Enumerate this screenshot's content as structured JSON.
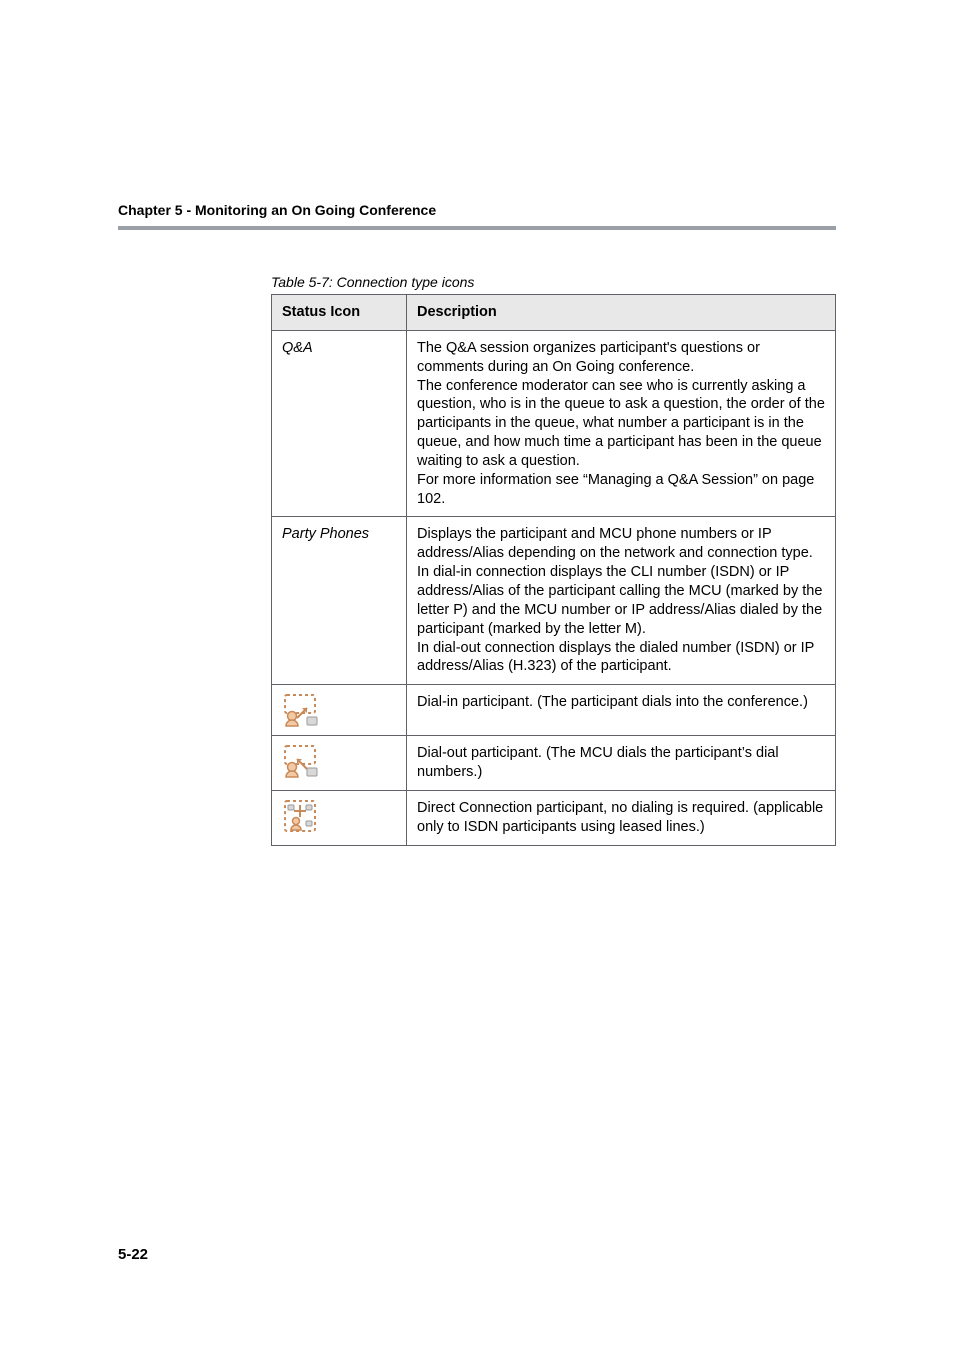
{
  "chapter": "Chapter 5 - Monitoring an On Going Conference",
  "table": {
    "caption": "Table 5-7: Connection type icons",
    "headers": {
      "col1": "Status Icon",
      "col2": "Description"
    },
    "rows": {
      "qa": {
        "label": "Q&A",
        "desc": "The Q&A session organizes participant's questions or comments during an On Going conference.\nThe conference moderator can see who is currently asking a question, who is in the queue to ask a question, the order of the participants in the queue, what number a participant is in the queue, and how much time a participant has been in the queue waiting to ask a question.\nFor more information see “Managing a Q&A Session” on page 102."
      },
      "party_phones": {
        "label": "Party Phones",
        "desc": "Displays the participant and MCU phone numbers or IP address/Alias depending on the network and connection type.\nIn dial-in connection displays the CLI number (ISDN) or IP address/Alias of the participant calling the MCU (marked by the letter P) and the MCU number or IP address/Alias dialed by the participant (marked by the letter M).\nIn dial-out connection displays the dialed number (ISDN) or IP address/Alias (H.323) of the participant."
      },
      "dial_in": {
        "desc": "Dial-in participant. (The participant dials into the conference.)"
      },
      "dial_out": {
        "desc": "Dial-out participant. (The MCU dials the participant’s dial numbers.)"
      },
      "direct": {
        "desc": "Direct Connection participant, no dialing is required. (applicable only to ISDN participants using leased lines.)"
      }
    }
  },
  "page_number": "5-22"
}
